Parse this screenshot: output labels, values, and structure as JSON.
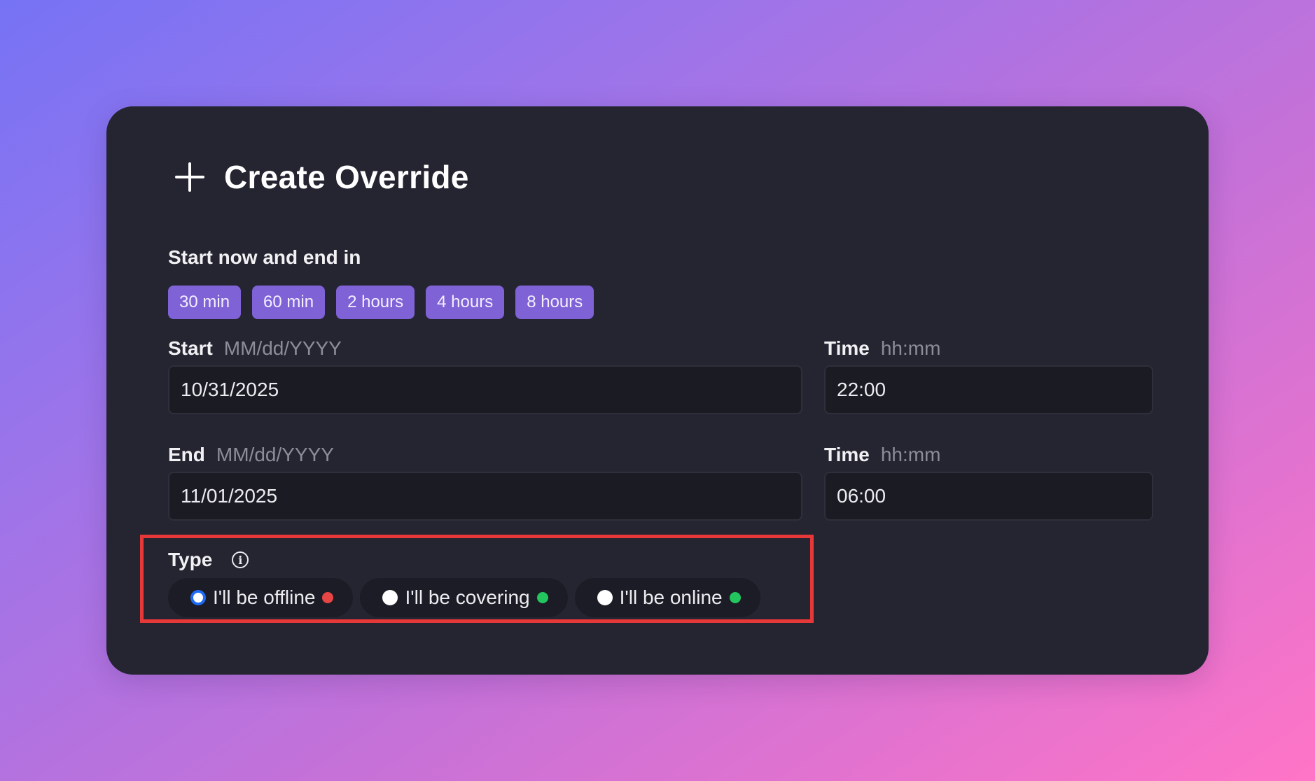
{
  "dialog": {
    "title": "Create Override"
  },
  "quick": {
    "label": "Start now and end in",
    "options": [
      "30 min",
      "60 min",
      "2 hours",
      "4 hours",
      "8 hours"
    ]
  },
  "start": {
    "label": "Start",
    "hint": "MM/dd/YYYY",
    "date_value": "10/31/2025",
    "time_label": "Time",
    "time_hint": "hh:mm",
    "time_value": "22:00"
  },
  "end": {
    "label": "End",
    "hint": "MM/dd/YYYY",
    "date_value": "11/01/2025",
    "time_label": "Time",
    "time_hint": "hh:mm",
    "time_value": "06:00"
  },
  "type": {
    "label": "Type",
    "info_icon": "info-icon",
    "options": [
      {
        "label": "I'll be offline",
        "selected": true,
        "dot_color": "#e84545"
      },
      {
        "label": "I'll be covering",
        "selected": false,
        "dot_color": "#22c55e"
      },
      {
        "label": "I'll be online",
        "selected": false,
        "dot_color": "#22c55e"
      }
    ]
  },
  "colors": {
    "accent": "#7f62d6",
    "selected_radio": "#1e6bf5",
    "highlight": "#e63838"
  }
}
